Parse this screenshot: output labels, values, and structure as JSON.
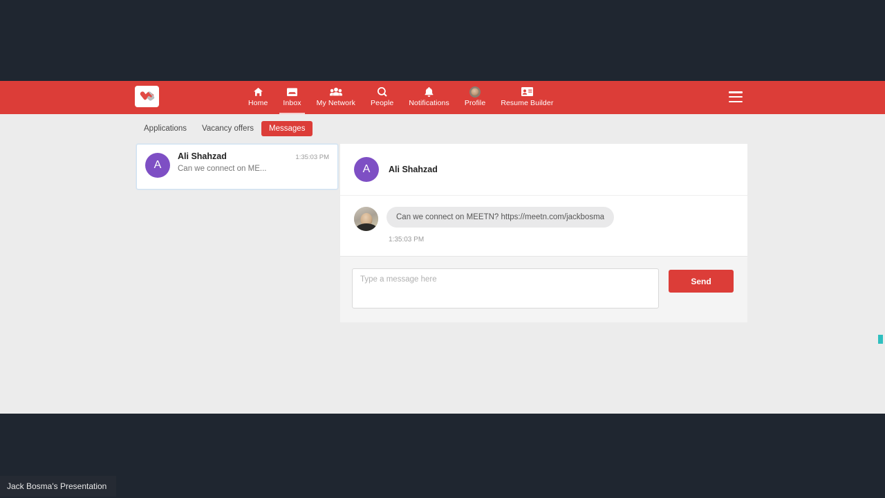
{
  "colors": {
    "brand_red": "#dc3d38",
    "page_bg": "#ececec",
    "avatar_purple": "#7e4fc4",
    "outer_bg": "#1f2630",
    "cursor_teal": "#2fbfbf"
  },
  "navbar": {
    "logo_name": "handshake-logo",
    "items": [
      {
        "label": "Home",
        "icon": "home-icon",
        "active": false
      },
      {
        "label": "Inbox",
        "icon": "inbox-icon",
        "active": true
      },
      {
        "label": "My Network",
        "icon": "people-group-icon",
        "active": false
      },
      {
        "label": "People",
        "icon": "search-icon",
        "active": false
      },
      {
        "label": "Notifications",
        "icon": "bell-icon",
        "active": false
      },
      {
        "label": "Profile",
        "icon": "profile-avatar-icon",
        "active": false
      },
      {
        "label": "Resume Builder",
        "icon": "id-card-icon",
        "active": false
      }
    ],
    "menu_icon": "hamburger-menu-icon"
  },
  "subtabs": [
    {
      "label": "Applications",
      "active": false
    },
    {
      "label": "Vacancy offers",
      "active": false
    },
    {
      "label": "Messages",
      "active": true
    }
  ],
  "conversation_list": [
    {
      "name": "Ali Shahzad",
      "initial": "A",
      "time": "1:35:03 PM",
      "preview": "Can we connect on ME...",
      "selected": true
    }
  ],
  "thread": {
    "header": {
      "name": "Ali Shahzad",
      "initial": "A"
    },
    "messages": [
      {
        "text": "Can we connect on MEETN? https://meetn.com/jackbosma",
        "time": "1:35:03 PM",
        "avatar": "photo-avatar"
      }
    ]
  },
  "composer": {
    "placeholder": "Type a message here",
    "value": "",
    "send_label": "Send"
  },
  "overlay": {
    "presentation_label": "Jack Bosma's Presentation"
  }
}
